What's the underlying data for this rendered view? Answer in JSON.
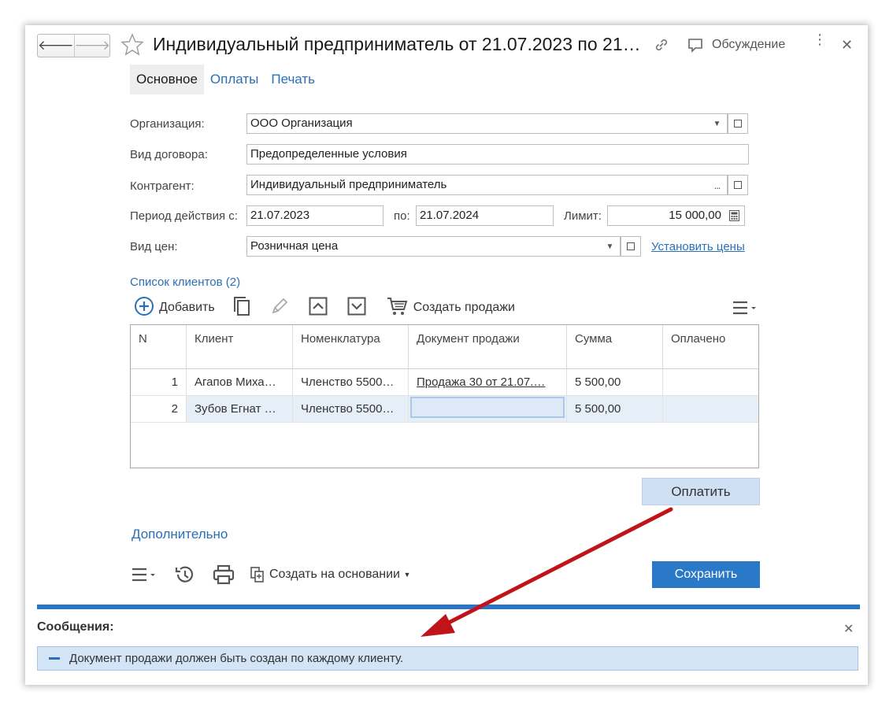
{
  "header": {
    "title": "Индивидуальный предприниматель  от 21.07.2023 по 21…",
    "discussion_label": "Обсуждение"
  },
  "tabs": [
    {
      "label": "Основное",
      "active": true
    },
    {
      "label": "Оплаты",
      "active": false
    },
    {
      "label": "Печать",
      "active": false
    }
  ],
  "form": {
    "org_label": "Организация:",
    "org_value": "ООО Организация",
    "contract_type_label": "Вид договора:",
    "contract_type_value": "Предопределенные условия",
    "counterparty_label": "Контрагент:",
    "counterparty_value": "Индивидуальный предприниматель",
    "period_label": "Период действия с:",
    "period_from": "21.07.2023",
    "period_to_label": "по:",
    "period_to": "21.07.2024",
    "limit_label": "Лимит:",
    "limit_value": "15 000,00",
    "price_type_label": "Вид цен:",
    "price_type_value": "Розничная цена",
    "set_prices_link": "Установить цены"
  },
  "clients": {
    "section_title": "Список клиентов  (2)",
    "add_label": "Добавить",
    "create_sales_label": "Создать продажи",
    "columns": [
      "N",
      "Клиент",
      "Номенклатура",
      "Документ продажи",
      "Сумма",
      "Оплачено"
    ],
    "rows": [
      {
        "n": "1",
        "client": "Агапов Миха…",
        "item": "Членство 5500…",
        "doc": "Продажа 30 от 21.07.…",
        "sum": "5 500,00",
        "paid": ""
      },
      {
        "n": "2",
        "client": "Зубов Егнат …",
        "item": "Членство 5500…",
        "doc": "",
        "sum": "5 500,00",
        "paid": ""
      }
    ]
  },
  "pay_button": "Оплатить",
  "additional_link": "Дополнительно",
  "footer": {
    "create_based_label": "Создать на основании",
    "save_button": "Сохранить"
  },
  "messages": {
    "title": "Сообщения:",
    "items": [
      "Документ продажи должен быть создан по каждому клиенту."
    ]
  },
  "colors": {
    "accent": "#2979c8",
    "link": "#2b6fb6",
    "annotation_arrow": "#c0141a"
  }
}
